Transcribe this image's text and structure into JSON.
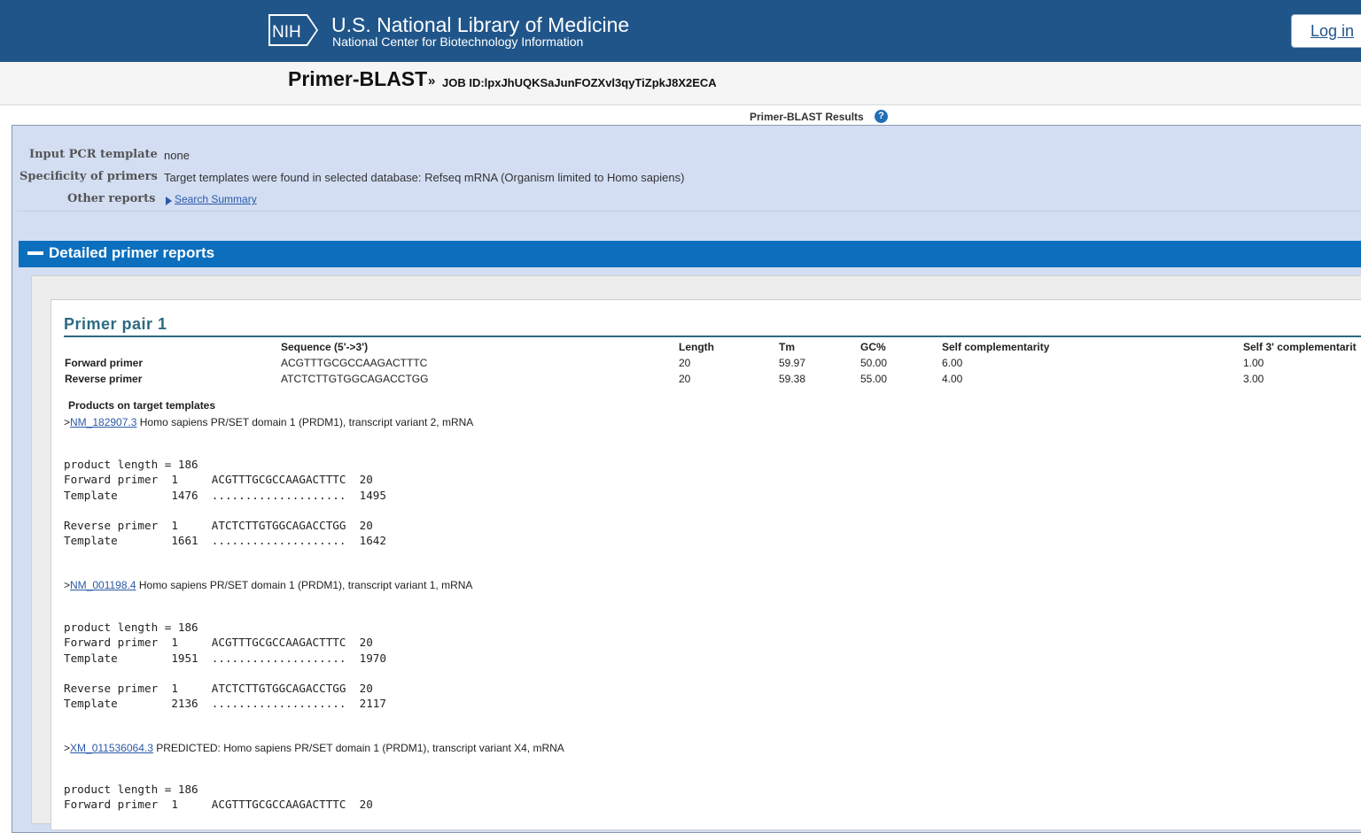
{
  "header": {
    "logo_text": "NIH",
    "title": "U.S. National Library of Medicine",
    "subtitle": "National Center for Biotechnology Information",
    "login_label": "Log in"
  },
  "titlebar": {
    "app_name": "Primer-BLAST",
    "separator": "»",
    "job_id": "JOB ID:lpxJhUQKSaJunFOZXvl3qyTiZpkJ8X2ECA"
  },
  "results_heading": "Primer-BLAST Results",
  "help_icon": "question-icon",
  "summary": {
    "input_label": "Input PCR template",
    "input_value": "none",
    "specificity_label": "Specificity of primers",
    "specificity_value": "Target templates were found in selected database: Refseq mRNA (Organism limited to Homo sapiens)",
    "other_label": "Other reports",
    "other_link": "Search Summary"
  },
  "detailed": {
    "title": "Detailed primer reports"
  },
  "primer_pair": {
    "title": "Primer pair 1",
    "columns": [
      "Sequence (5'->3')",
      "Length",
      "Tm",
      "GC%",
      "Self complementarity",
      "Self 3' complementarit"
    ],
    "rows": [
      {
        "name": "Forward primer",
        "sequence": "ACGTTTGCGCCAAGACTTTC",
        "length": "20",
        "tm": "59.97",
        "gc": "50.00",
        "self": "6.00",
        "self3": "1.00"
      },
      {
        "name": "Reverse primer",
        "sequence": "ATCTCTTGTGGCAGACCTGG",
        "length": "20",
        "tm": "59.38",
        "gc": "55.00",
        "self": "4.00",
        "self3": "3.00"
      }
    ]
  },
  "products": {
    "title": "Products on target templates",
    "hits": [
      {
        "prefix": ">",
        "accession": "NM_182907.3",
        "description": " Homo sapiens PR/SET domain 1 (PRDM1), transcript variant 2, mRNA",
        "alignment": "product length = 186\nForward primer  1     ACGTTTGCGCCAAGACTTTC  20\nTemplate        1476  ....................  1495\n\nReverse primer  1     ATCTCTTGTGGCAGACCTGG  20\nTemplate        1661  ....................  1642"
      },
      {
        "prefix": ">",
        "accession": "NM_001198.4",
        "description": " Homo sapiens PR/SET domain 1 (PRDM1), transcript variant 1, mRNA",
        "alignment": "product length = 186\nForward primer  1     ACGTTTGCGCCAAGACTTTC  20\nTemplate        1951  ....................  1970\n\nReverse primer  1     ATCTCTTGTGGCAGACCTGG  20\nTemplate        2136  ....................  2117"
      },
      {
        "prefix": ">",
        "accession": "XM_011536064.3",
        "description": " PREDICTED: Homo sapiens PR/SET domain 1 (PRDM1), transcript variant X4, mRNA",
        "alignment": "product length = 186\nForward primer  1     ACGTTTGCGCCAAGACTTTC  20"
      }
    ]
  }
}
